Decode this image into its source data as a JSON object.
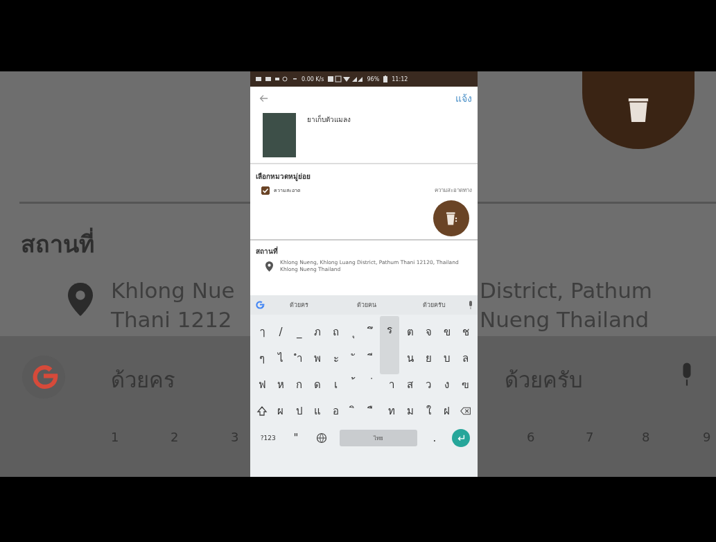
{
  "backdrop": {
    "heading": "สถานที่",
    "address_lines": [
      "Khlong Nue",
      "District, Pathum",
      "Thani 1212",
      "Nueng Thailand"
    ],
    "suggestions": [
      "ด้วยคร",
      "ด้วยครับ"
    ],
    "digits": [
      "1",
      "2",
      "3",
      "6",
      "7",
      "8",
      "9"
    ]
  },
  "status_bar": {
    "speed": "0.00 K/s",
    "battery": "96%",
    "time": "11:12"
  },
  "app_bar": {
    "action": "แจ้ง"
  },
  "post": {
    "value": "ยาเก็บตัวแมลง"
  },
  "category": {
    "title": "เลือกหมวดหมู่ย่อย",
    "option": {
      "label": "ความสะอาด",
      "checked": true
    },
    "note": "ความสะอาดทาง"
  },
  "place": {
    "title": "สถานที่",
    "address": "Khlong Nueng, Khlong Luang District, Pathum Thani 12120, Thailand Khlong Nueng Thailand"
  },
  "keyboard": {
    "suggestions": [
      "ด้วยคร",
      "ด้วยคน",
      "ด้วยครับ"
    ],
    "rows": [
      [
        "ๅ",
        "/",
        "_",
        "ภ",
        "ถ",
        "ุ",
        "ึ",
        null,
        "ต",
        "จ",
        "ข",
        "ช"
      ],
      [
        "ๆ",
        "ไ",
        "ำ",
        "พ",
        "ะ",
        "ั",
        "ี",
        null,
        "น",
        "ย",
        "บ",
        "ล"
      ],
      [
        "ฟ",
        "ห",
        "ก",
        "ด",
        "เ",
        "้",
        "่",
        "า",
        "ส",
        "ว",
        "ง",
        "ฃ"
      ],
      [
        {
          "kind": "shift"
        },
        "ผ",
        "ป",
        "แ",
        "อ",
        "ิ",
        "ื",
        "ท",
        "ม",
        "ใ",
        "ฝ",
        {
          "kind": "backspace"
        }
      ]
    ],
    "preview": "ร",
    "symbols": "?123",
    "comma": "\"",
    "space": "ไทย",
    "period": "."
  }
}
